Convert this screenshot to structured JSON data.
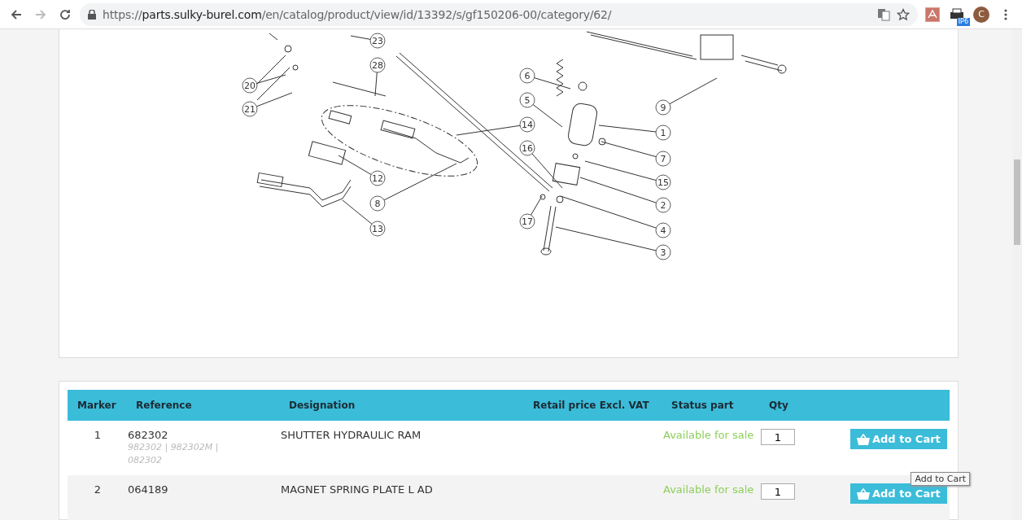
{
  "browser": {
    "url": {
      "scheme": "https://",
      "host": "parts.sulky-burel.com",
      "path": "/en/catalog/product/view/id/13392/s/gf150206-00/category/62/"
    },
    "back_disabled": false,
    "forward_disabled": true,
    "extension_badge": "IP6",
    "avatar_letter": "C"
  },
  "diagram": {
    "callouts": [
      "23",
      "28",
      "20",
      "21",
      "6",
      "5",
      "14",
      "16",
      "12",
      "8",
      "13",
      "17",
      "9",
      "1",
      "7",
      "15",
      "2",
      "4",
      "3"
    ]
  },
  "table": {
    "columns": [
      "Marker",
      "Reference",
      "Designation",
      "Retail price Excl. VAT",
      "Status part",
      "Qty"
    ],
    "rows": [
      {
        "marker": "1",
        "reference": "682302",
        "alt_references": "982302 | 982302M | 082302",
        "designation": "SHUTTER HYDRAULIC RAM",
        "status": "Available for sale",
        "qty": "1",
        "button": "Add to Cart"
      },
      {
        "marker": "2",
        "reference": "064189",
        "designation": "MAGNET SPRING PLATE L AD",
        "status": "Available for sale",
        "qty": "1",
        "button": "Add to Cart"
      }
    ]
  },
  "tooltip": "Add to Cart"
}
